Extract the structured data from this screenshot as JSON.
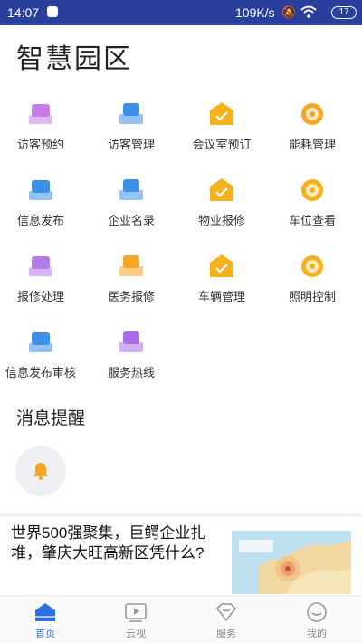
{
  "status_bar": {
    "time": "14:07",
    "network_speed": "109K/s",
    "battery": "17"
  },
  "page": {
    "title": "智慧园区"
  },
  "services": [
    {
      "label": "访客预约",
      "icon": "visitor-booking-icon",
      "color": "#c77de6"
    },
    {
      "label": "访客管理",
      "icon": "visitor-manage-icon",
      "color": "#3d8fe8"
    },
    {
      "label": "会议室预订",
      "icon": "meeting-room-icon",
      "color": "#f5b21d"
    },
    {
      "label": "能耗管理",
      "icon": "energy-icon",
      "color": "#f5a623"
    },
    {
      "label": "信息发布",
      "icon": "info-publish-icon",
      "color": "#3d8fe8"
    },
    {
      "label": "企业名录",
      "icon": "company-directory-icon",
      "color": "#3d8fe8"
    },
    {
      "label": "物业报修",
      "icon": "property-repair-icon",
      "color": "#f5b21d"
    },
    {
      "label": "车位查看",
      "icon": "parking-icon",
      "color": "#f5b21d"
    },
    {
      "label": "报修处理",
      "icon": "repair-process-icon",
      "color": "#b07ce8"
    },
    {
      "label": "医务报修",
      "icon": "medical-repair-icon",
      "color": "#f5a623"
    },
    {
      "label": "车辆管理",
      "icon": "vehicle-icon",
      "color": "#f5b21d"
    },
    {
      "label": "照明控制",
      "icon": "lighting-icon",
      "color": "#f5b21d"
    },
    {
      "label": "信息发布审核",
      "icon": "info-review-icon",
      "color": "#3d8fe8"
    },
    {
      "label": "服务热线",
      "icon": "service-hotline-icon",
      "color": "#a86be8"
    }
  ],
  "notifications": {
    "title": "消息提醒"
  },
  "news": {
    "headline": "世界500强聚集，巨鳄企业扎堆，肇庆大旺高新区凭什么?"
  },
  "tabbar": {
    "tabs": [
      {
        "label": "首页",
        "active": true
      },
      {
        "label": "云视",
        "active": false
      },
      {
        "label": "服务",
        "active": false
      },
      {
        "label": "我的",
        "active": false
      }
    ]
  },
  "colors": {
    "status_bar": "#2a3f9c",
    "accent": "#2f6fe0"
  }
}
